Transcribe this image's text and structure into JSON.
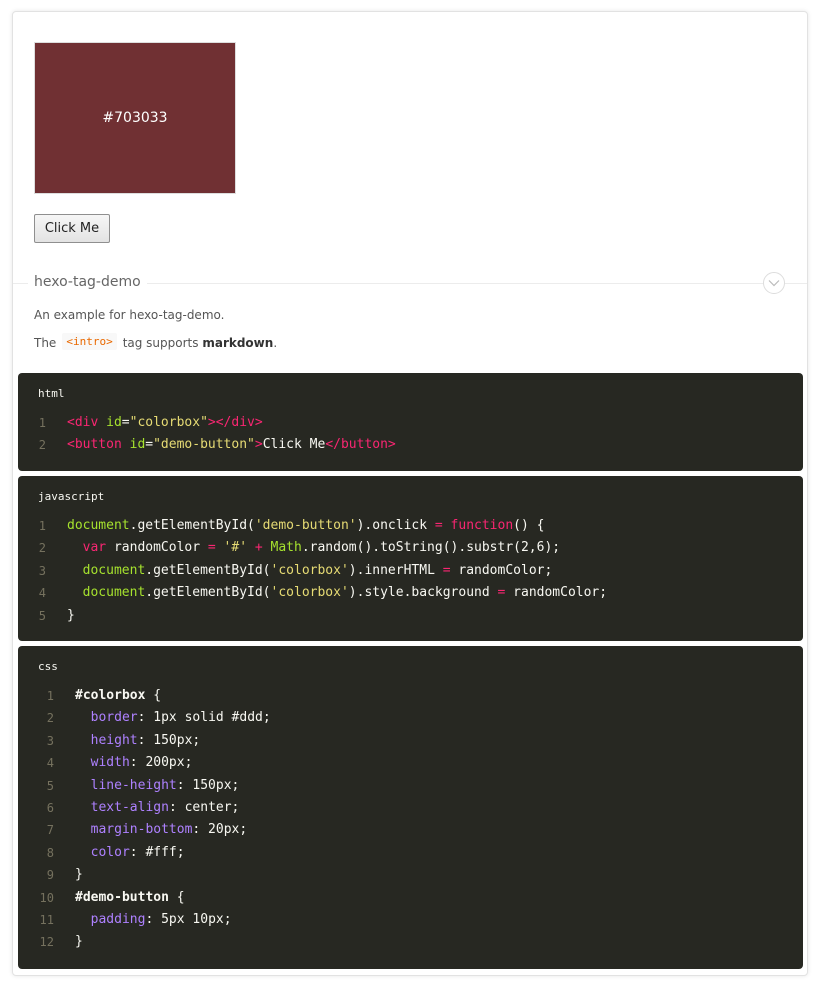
{
  "demo": {
    "color_value": "#703033",
    "box_color": "#703033",
    "button_label": "Click Me"
  },
  "section": {
    "title": "hexo-tag-demo",
    "description": "An example for hexo-tag-demo.",
    "note_prefix": "The",
    "note_code": "<intro>",
    "note_middle": "tag supports",
    "note_bold": "markdown",
    "note_suffix": "."
  },
  "code_blocks": [
    {
      "language": "html",
      "lines": [
        [
          [
            "<div ",
            "tag"
          ],
          [
            "id",
            "attr"
          ],
          [
            "=",
            "plain"
          ],
          [
            "\"colorbox\"",
            "str"
          ],
          [
            "></div>",
            "tag"
          ]
        ],
        [
          [
            "<button ",
            "tag"
          ],
          [
            "id",
            "attr"
          ],
          [
            "=",
            "plain"
          ],
          [
            "\"demo-button\"",
            "str"
          ],
          [
            ">",
            "tag"
          ],
          [
            "Click Me",
            "plain"
          ],
          [
            "</button>",
            "tag"
          ]
        ]
      ]
    },
    {
      "language": "javascript",
      "lines": [
        [
          [
            "document",
            "green"
          ],
          [
            ".getElementById(",
            "plain"
          ],
          [
            "'demo-button'",
            "str"
          ],
          [
            ").onclick ",
            "plain"
          ],
          [
            "=",
            "pink"
          ],
          [
            " ",
            "plain"
          ],
          [
            "function",
            "pink"
          ],
          [
            "() {",
            "plain"
          ]
        ],
        [
          [
            "  ",
            "plain"
          ],
          [
            "var",
            "pink"
          ],
          [
            " randomColor ",
            "plain"
          ],
          [
            "=",
            "pink"
          ],
          [
            " ",
            "plain"
          ],
          [
            "'#'",
            "str"
          ],
          [
            " ",
            "plain"
          ],
          [
            "+",
            "pink"
          ],
          [
            " ",
            "plain"
          ],
          [
            "Math",
            "green"
          ],
          [
            ".random().toString().substr(2,6);",
            "plain"
          ]
        ],
        [
          [
            "  ",
            "plain"
          ],
          [
            "document",
            "green"
          ],
          [
            ".getElementById(",
            "plain"
          ],
          [
            "'colorbox'",
            "str"
          ],
          [
            ").innerHTML ",
            "plain"
          ],
          [
            "=",
            "pink"
          ],
          [
            " randomColor;",
            "plain"
          ]
        ],
        [
          [
            "  ",
            "plain"
          ],
          [
            "document",
            "green"
          ],
          [
            ".getElementById(",
            "plain"
          ],
          [
            "'colorbox'",
            "str"
          ],
          [
            ").style.background ",
            "plain"
          ],
          [
            "=",
            "pink"
          ],
          [
            " randomColor;",
            "plain"
          ]
        ],
        [
          [
            "}",
            "plain"
          ]
        ]
      ]
    },
    {
      "language": "css",
      "lines": [
        [
          [
            "#colorbox",
            "bold"
          ],
          [
            " {",
            "plain"
          ]
        ],
        [
          [
            "  ",
            "plain"
          ],
          [
            "border",
            "purple"
          ],
          [
            ": 1px solid #ddd;",
            "plain"
          ]
        ],
        [
          [
            "  ",
            "plain"
          ],
          [
            "height",
            "purple"
          ],
          [
            ": 150px;",
            "plain"
          ]
        ],
        [
          [
            "  ",
            "plain"
          ],
          [
            "width",
            "purple"
          ],
          [
            ": 200px;",
            "plain"
          ]
        ],
        [
          [
            "  ",
            "plain"
          ],
          [
            "line-height",
            "purple"
          ],
          [
            ": 150px;",
            "plain"
          ]
        ],
        [
          [
            "  ",
            "plain"
          ],
          [
            "text-align",
            "purple"
          ],
          [
            ": center;",
            "plain"
          ]
        ],
        [
          [
            "  ",
            "plain"
          ],
          [
            "margin-bottom",
            "purple"
          ],
          [
            ": 20px;",
            "plain"
          ]
        ],
        [
          [
            "  ",
            "plain"
          ],
          [
            "color",
            "purple"
          ],
          [
            ": #fff;",
            "plain"
          ]
        ],
        [
          [
            "}",
            "plain"
          ]
        ],
        [
          [
            "#demo-button",
            "bold"
          ],
          [
            " {",
            "plain"
          ]
        ],
        [
          [
            "  ",
            "plain"
          ],
          [
            "padding",
            "purple"
          ],
          [
            ": 5px 10px;",
            "plain"
          ]
        ],
        [
          [
            "}",
            "plain"
          ]
        ]
      ]
    }
  ],
  "colors": {
    "code_background": "#272822",
    "tag": "#f92672",
    "attr": "#a6e22e",
    "string": "#e6db74",
    "property": "#ae81ff",
    "line_number": "#75715e"
  },
  "icons": {
    "toggle": "chevron-down-icon"
  }
}
